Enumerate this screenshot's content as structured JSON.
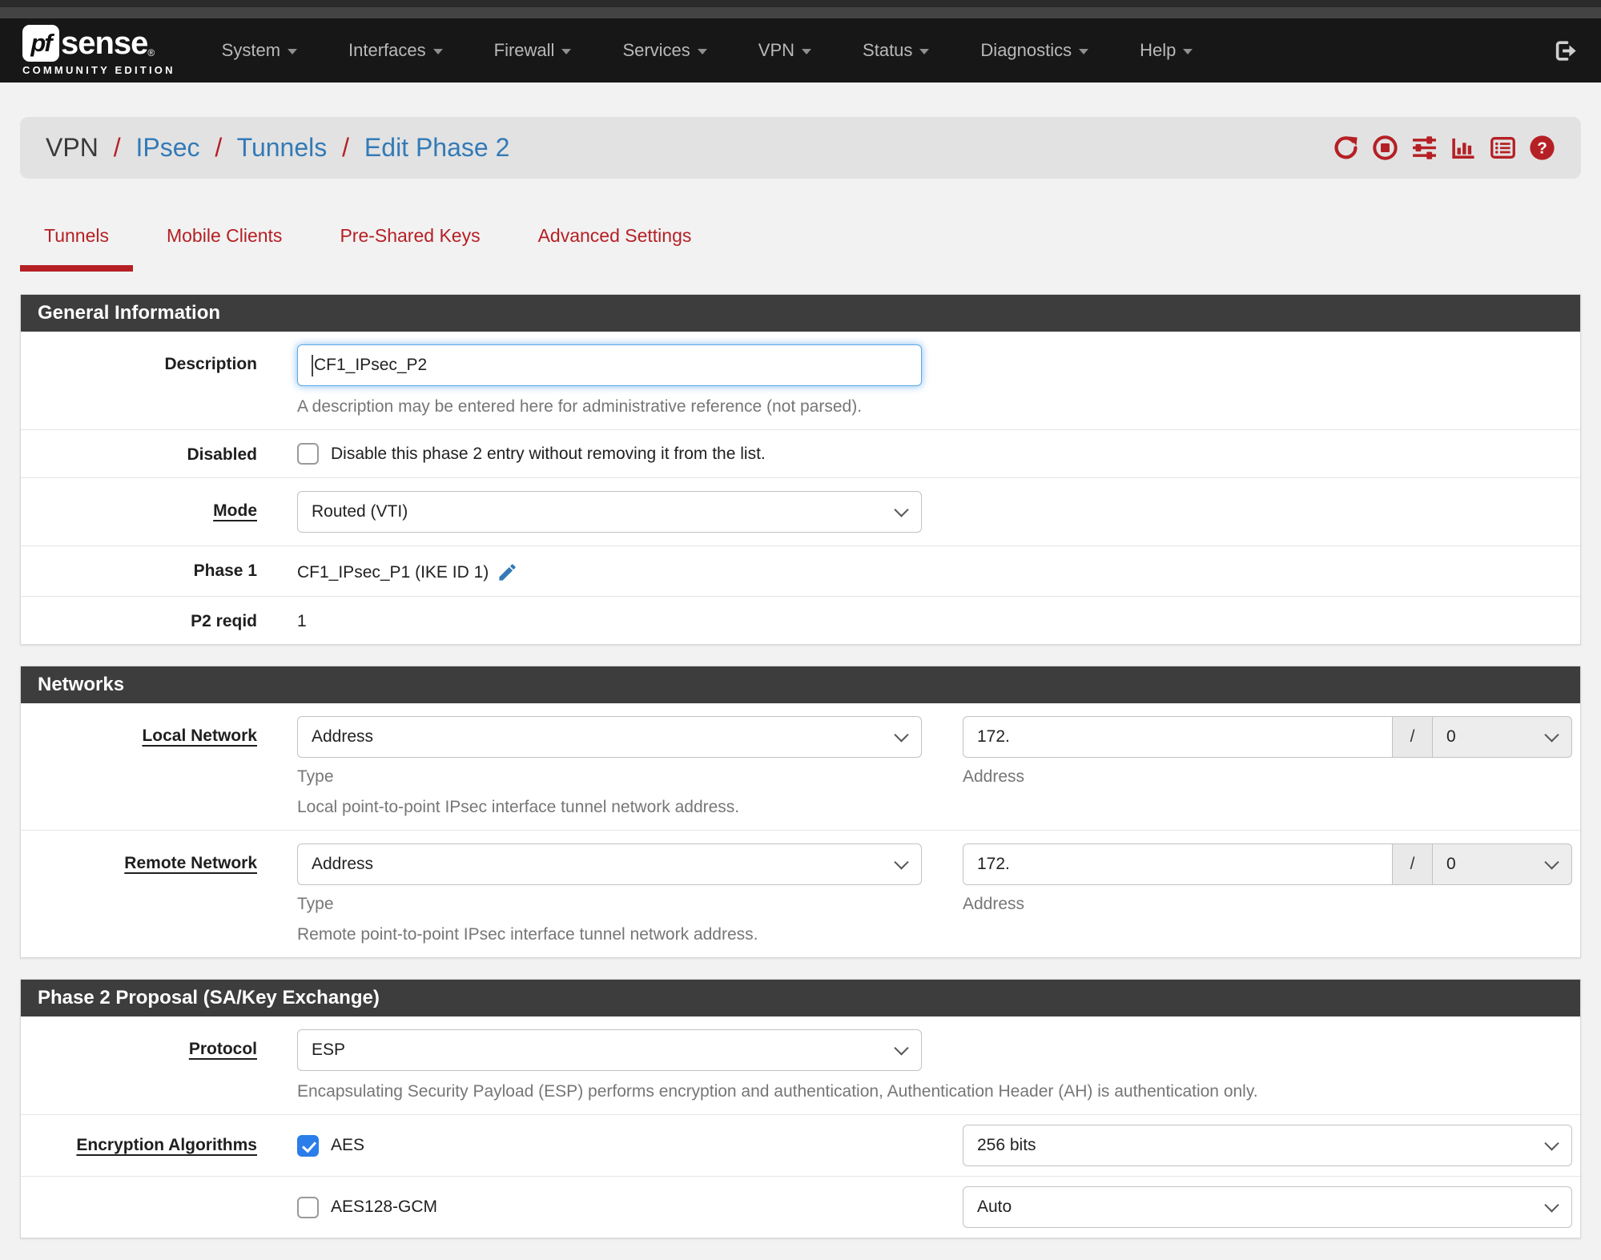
{
  "colors": {
    "accent_red": "#b52025",
    "link_blue": "#337ab7",
    "checkbox_blue": "#2b7de9",
    "panel_header_bg": "#3d3d3d"
  },
  "navbar": {
    "brand": {
      "pf": "pf",
      "sense": "sense",
      "registered": "®",
      "edition": "COMMUNITY EDITION"
    },
    "items": [
      {
        "label": "System"
      },
      {
        "label": "Interfaces"
      },
      {
        "label": "Firewall"
      },
      {
        "label": "Services"
      },
      {
        "label": "VPN"
      },
      {
        "label": "Status"
      },
      {
        "label": "Diagnostics"
      },
      {
        "label": "Help"
      }
    ],
    "logout_icon": "sign-out-icon"
  },
  "breadcrumb": {
    "separator": "/",
    "current": "VPN",
    "links": [
      {
        "label": "IPsec"
      },
      {
        "label": "Tunnels"
      },
      {
        "label": "Edit Phase 2"
      }
    ],
    "action_icons": [
      "refresh-icon",
      "stop-circle-icon",
      "sliders-icon",
      "bar-chart-icon",
      "list-icon",
      "help-icon"
    ]
  },
  "tabs": [
    {
      "label": "Tunnels",
      "active": true
    },
    {
      "label": "Mobile Clients",
      "active": false
    },
    {
      "label": "Pre-Shared Keys",
      "active": false
    },
    {
      "label": "Advanced Settings",
      "active": false
    }
  ],
  "general": {
    "title": "General Information",
    "description_label": "Description",
    "description_value": "CF1_IPsec_P2",
    "description_help": "A description may be entered here for administrative reference (not parsed).",
    "disabled_label": "Disabled",
    "disabled_checkbox_label": "Disable this phase 2 entry without removing it from the list.",
    "disabled_checked": false,
    "mode_label": "Mode",
    "mode_value": "Routed (VTI)",
    "phase1_label": "Phase 1",
    "phase1_value": "CF1_IPsec_P1 (IKE ID 1)",
    "p2reqid_label": "P2 reqid",
    "p2reqid_value": "1"
  },
  "networks": {
    "title": "Networks",
    "local": {
      "label": "Local Network",
      "type_value": "Address",
      "type_help": "Type",
      "address_value": "172.",
      "slash": "/",
      "mask_value": "0",
      "address_help": "Address",
      "row_help": "Local point-to-point IPsec interface tunnel network address."
    },
    "remote": {
      "label": "Remote Network",
      "type_value": "Address",
      "type_help": "Type",
      "address_value": "172.",
      "slash": "/",
      "mask_value": "0",
      "address_help": "Address",
      "row_help": "Remote point-to-point IPsec interface tunnel network address."
    }
  },
  "proposal": {
    "title": "Phase 2 Proposal (SA/Key Exchange)",
    "protocol_label": "Protocol",
    "protocol_value": "ESP",
    "protocol_help": "Encapsulating Security Payload (ESP) performs encryption and authentication, Authentication Header (AH) is authentication only.",
    "enc_label": "Encryption Algorithms",
    "algorithms": [
      {
        "name": "AES",
        "checked": true,
        "keylen": "256 bits"
      },
      {
        "name": "AES128-GCM",
        "checked": false,
        "keylen": "Auto"
      }
    ]
  }
}
